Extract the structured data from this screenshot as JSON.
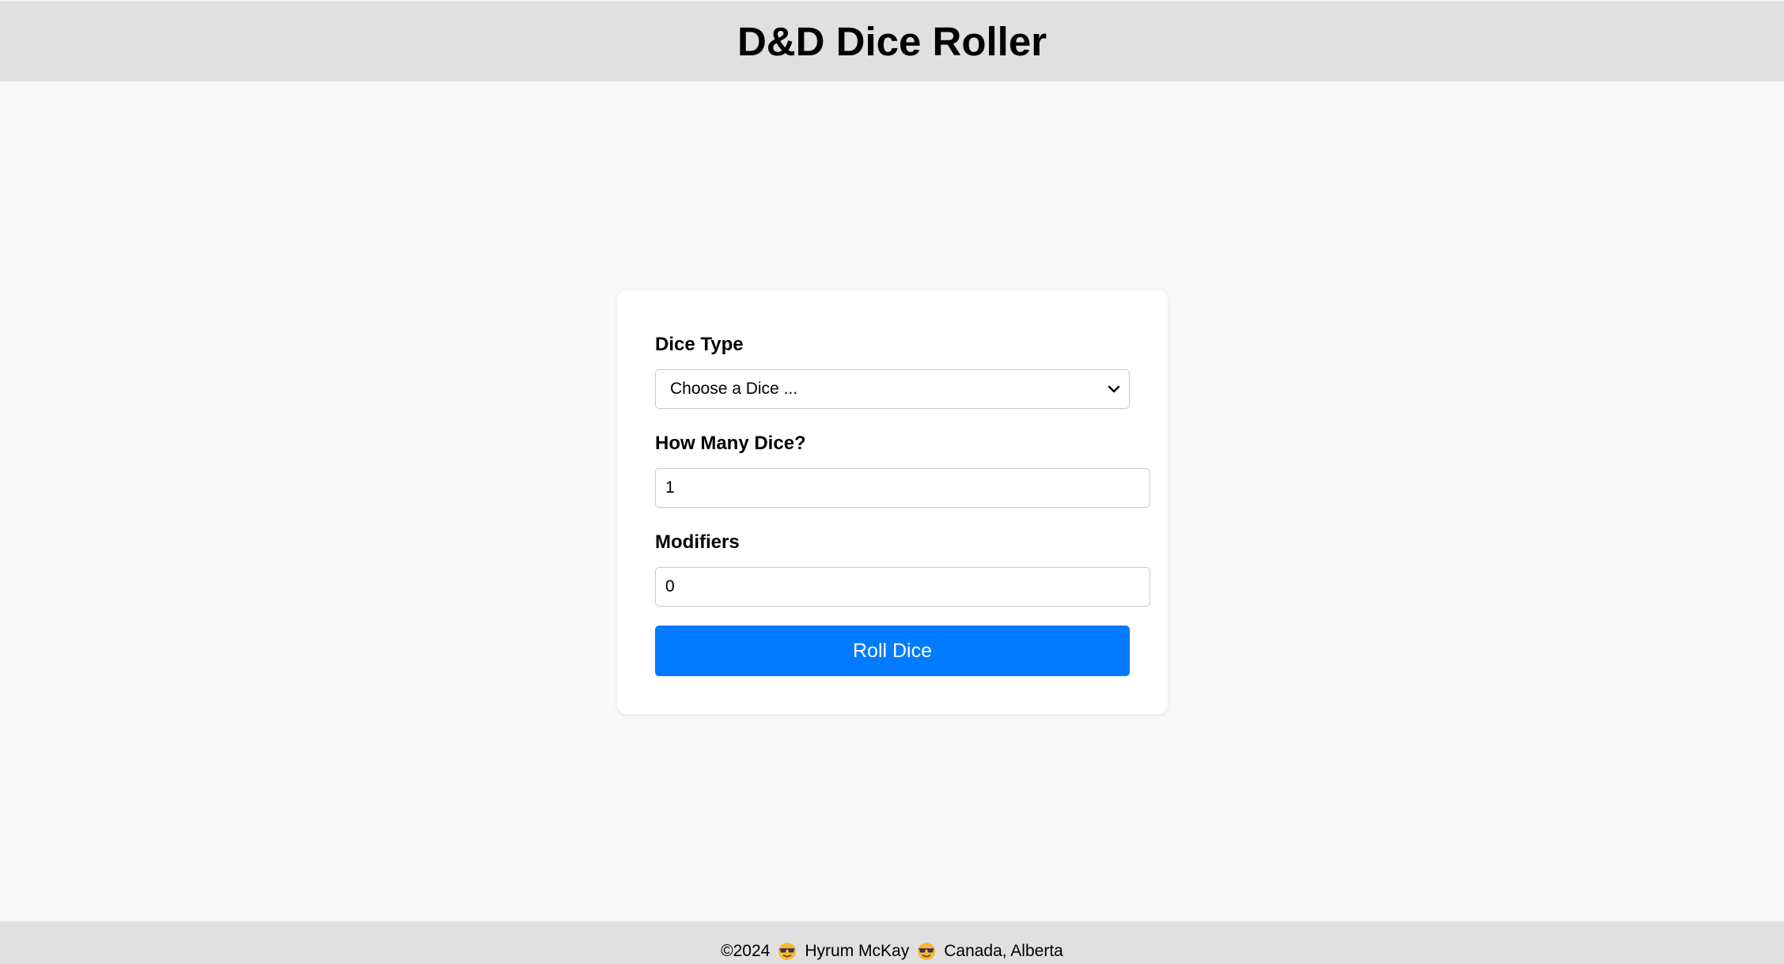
{
  "header": {
    "title": "D&D Dice Roller"
  },
  "form": {
    "dice_type_label": "Dice Type",
    "dice_type_selected": "Choose a Dice ...",
    "count_label": "How Many Dice?",
    "count_value": "1",
    "modifiers_label": "Modifiers",
    "modifiers_value": "0",
    "roll_button_label": "Roll Dice"
  },
  "footer": {
    "copyright": "©2024",
    "author": "Hyrum McKay",
    "location": "Canada, Alberta",
    "emoji_icon": "sunglasses-smiley-icon"
  },
  "colors": {
    "accent": "#007bff",
    "header_bg": "#e0e0e0",
    "page_bg": "#f8f8f8"
  }
}
